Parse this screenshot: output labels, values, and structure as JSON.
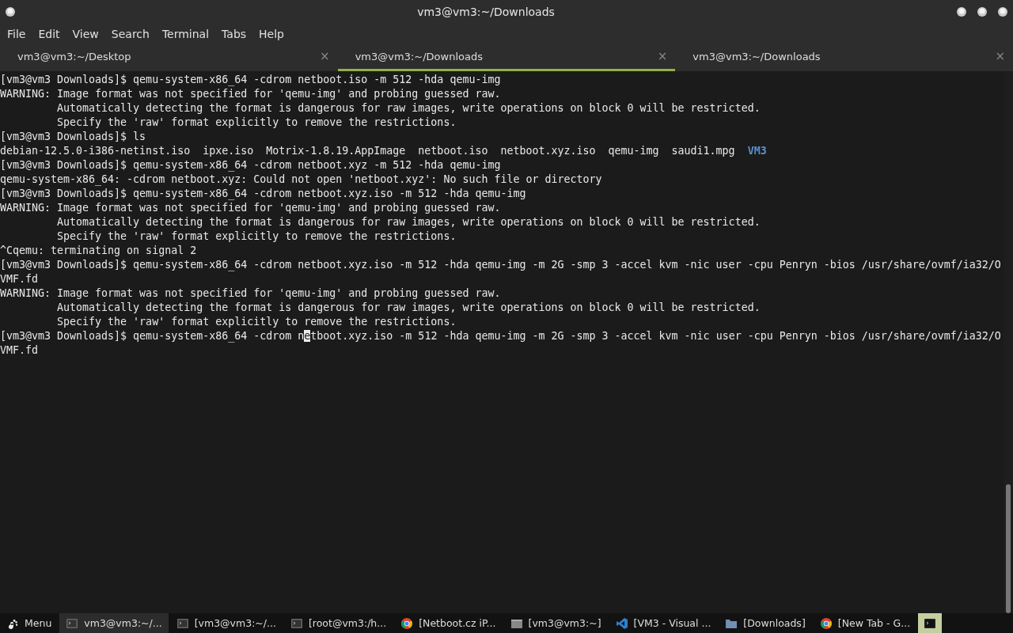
{
  "window": {
    "title": "vm3@vm3:~/Downloads"
  },
  "menu": [
    "File",
    "Edit",
    "View",
    "Search",
    "Terminal",
    "Tabs",
    "Help"
  ],
  "tabs": [
    {
      "label": "vm3@vm3:~/Desktop",
      "selected": false,
      "close": "×"
    },
    {
      "label": "vm3@vm3:~/Downloads",
      "selected": true,
      "close": "×"
    },
    {
      "label": "vm3@vm3:~/Downloads",
      "selected": false,
      "close": "×"
    }
  ],
  "terminal": {
    "lines": [
      [
        {
          "kind": "text",
          "text": "[vm3@vm3 Downloads]$ qemu-system-x86_64 -cdrom netboot.iso -m 512 -hda qemu-img"
        }
      ],
      [
        {
          "kind": "text",
          "text": "WARNING: Image format was not specified for 'qemu-img' and probing guessed raw."
        }
      ],
      [
        {
          "kind": "text",
          "text": "         Automatically detecting the format is dangerous for raw images, write operations on block 0 will be restricted."
        }
      ],
      [
        {
          "kind": "text",
          "text": "         Specify the 'raw' format explicitly to remove the restrictions."
        }
      ],
      [
        {
          "kind": "text",
          "text": "[vm3@vm3 Downloads]$ ls"
        }
      ],
      [
        {
          "kind": "text",
          "text": "debian-12.5.0-i386-netinst.iso  ipxe.iso  Motrix-1.8.19.AppImage  netboot.iso  netboot.xyz.iso  qemu-img  saudi1.mpg  "
        },
        {
          "kind": "directory",
          "text": "VM3"
        }
      ],
      [
        {
          "kind": "text",
          "text": "[vm3@vm3 Downloads]$ qemu-system-x86_64 -cdrom netboot.xyz -m 512 -hda qemu-img"
        }
      ],
      [
        {
          "kind": "text",
          "text": "qemu-system-x86_64: -cdrom netboot.xyz: Could not open 'netboot.xyz': No such file or directory"
        }
      ],
      [
        {
          "kind": "text",
          "text": "[vm3@vm3 Downloads]$ qemu-system-x86_64 -cdrom netboot.xyz.iso -m 512 -hda qemu-img"
        }
      ],
      [
        {
          "kind": "text",
          "text": "WARNING: Image format was not specified for 'qemu-img' and probing guessed raw."
        }
      ],
      [
        {
          "kind": "text",
          "text": "         Automatically detecting the format is dangerous for raw images, write operations on block 0 will be restricted."
        }
      ],
      [
        {
          "kind": "text",
          "text": "         Specify the 'raw' format explicitly to remove the restrictions."
        }
      ],
      [
        {
          "kind": "text",
          "text": "^Cqemu: terminating on signal 2"
        }
      ],
      [
        {
          "kind": "text",
          "text": "[vm3@vm3 Downloads]$ qemu-system-x86_64 -cdrom netboot.xyz.iso -m 512 -hda qemu-img -m 2G -smp 3 -accel kvm -nic user -cpu Penryn -bios /usr/share/ovmf/ia32/O"
        }
      ],
      [
        {
          "kind": "text",
          "text": "VMF.fd"
        }
      ],
      [
        {
          "kind": "text",
          "text": "WARNING: Image format was not specified for 'qemu-img' and probing guessed raw."
        }
      ],
      [
        {
          "kind": "text",
          "text": "         Automatically detecting the format is dangerous for raw images, write operations on block 0 will be restricted."
        }
      ],
      [
        {
          "kind": "text",
          "text": "         Specify the 'raw' format explicitly to remove the restrictions."
        }
      ],
      [
        {
          "kind": "text",
          "text": "[vm3@vm3 Downloads]$ qemu-system-x86_64 -cdrom n"
        },
        {
          "kind": "cursor",
          "text": "e"
        },
        {
          "kind": "text",
          "text": "tboot.xyz.iso -m 512 -hda qemu-img -m 2G -smp 3 -accel kvm -nic user -cpu Penryn -bios /usr/share/ovmf/ia32/O"
        }
      ],
      [
        {
          "kind": "text",
          "text": "VMF.fd"
        }
      ]
    ]
  },
  "taskbar": {
    "items": [
      {
        "kind": "menu",
        "label": "Menu",
        "selected": false
      },
      {
        "kind": "terminal",
        "label": "vm3@vm3:~/...",
        "selected": true
      },
      {
        "kind": "terminal",
        "label": "[vm3@vm3:~/...",
        "selected": false
      },
      {
        "kind": "terminal",
        "label": "[root@vm3:/h...",
        "selected": false
      },
      {
        "kind": "chrome",
        "label": "[Netboot.cz iP...",
        "selected": false
      },
      {
        "kind": "window",
        "label": "[vm3@vm3:~]",
        "selected": false
      },
      {
        "kind": "vscode",
        "label": "[VM3 - Visual ...",
        "selected": false
      },
      {
        "kind": "folder",
        "label": "[Downloads]",
        "selected": false
      },
      {
        "kind": "chrome",
        "label": "[New Tab - G...",
        "selected": false
      }
    ],
    "launcher": {
      "kind": "terminal",
      "highlighted": true
    }
  }
}
